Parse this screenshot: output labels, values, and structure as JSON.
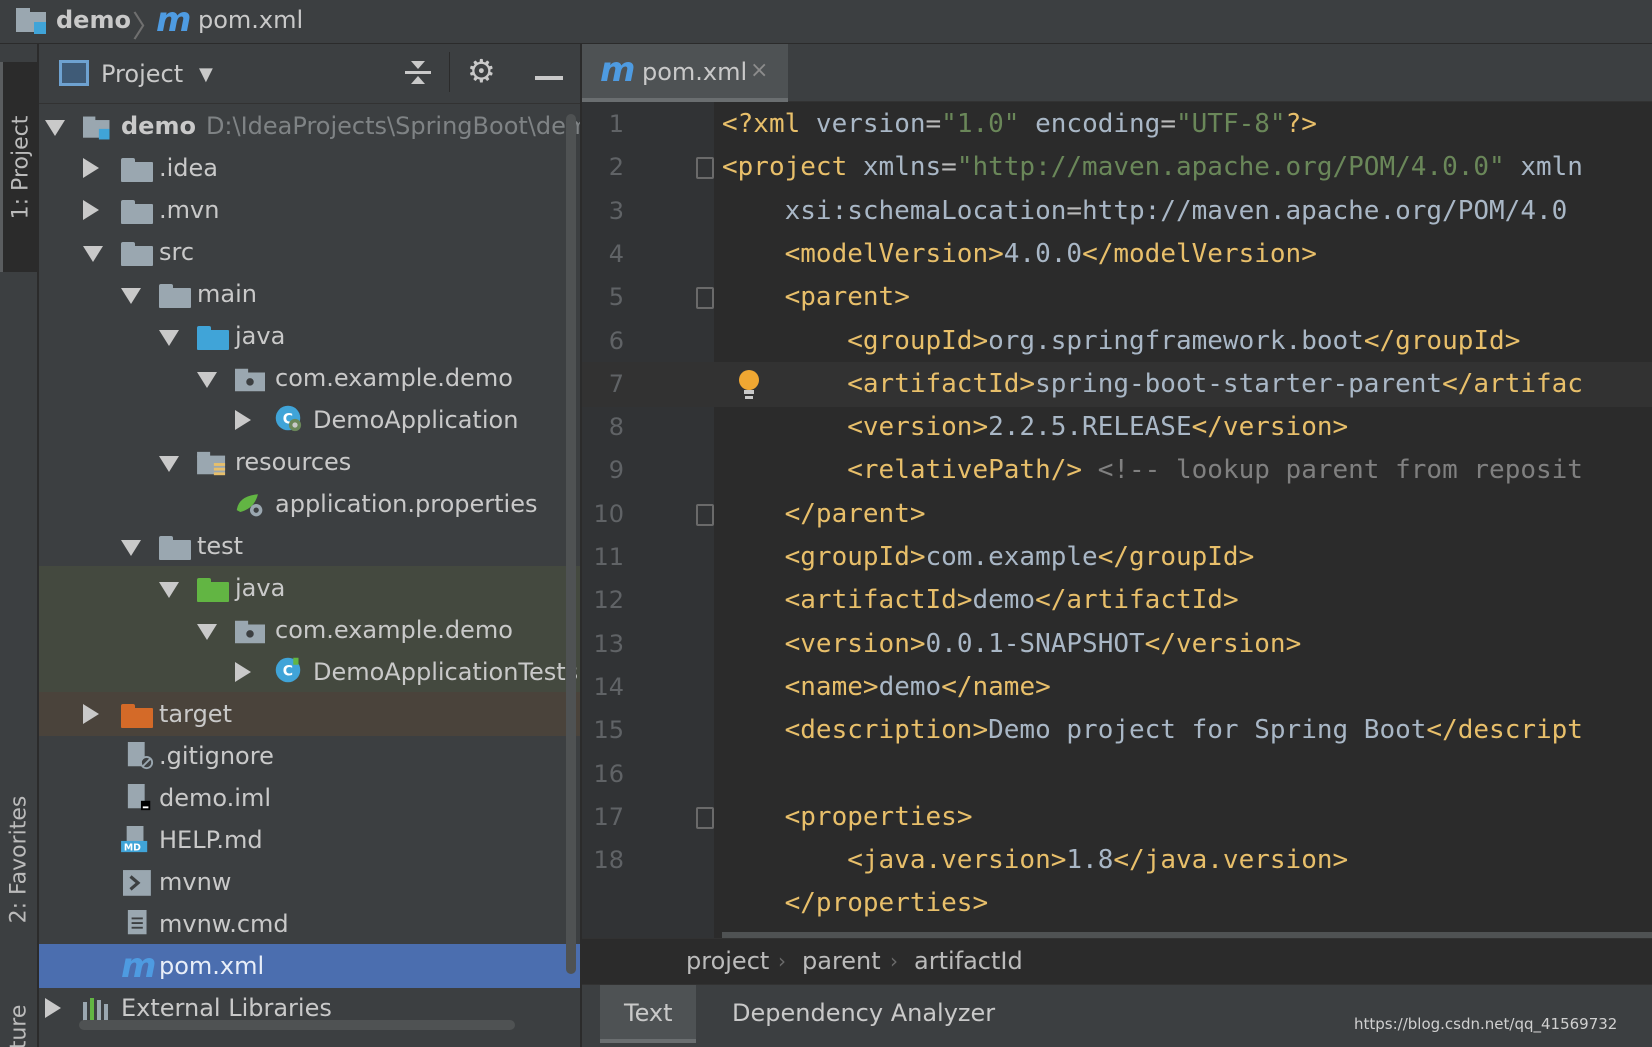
{
  "navbar": {
    "project": "demo",
    "file_icon": "m",
    "file": "pom.xml"
  },
  "left_stripe": {
    "tabs": [
      {
        "label": "1: Project"
      },
      {
        "label": "2: Favorites"
      },
      {
        "label": "ructure"
      }
    ]
  },
  "project_panel": {
    "title": "Project",
    "icons": [
      "collapse-all-icon",
      "gear-icon",
      "minimize-icon"
    ],
    "tree": [
      {
        "label": "demo",
        "path": "D:\\IdeaProjects\\SpringBoot\\dem",
        "icon": "module-folder"
      },
      {
        "label": ".idea",
        "icon": "folder"
      },
      {
        "label": ".mvn",
        "icon": "folder"
      },
      {
        "label": "src",
        "icon": "folder"
      },
      {
        "label": "main",
        "icon": "folder"
      },
      {
        "label": "java",
        "icon": "source-folder"
      },
      {
        "label": "com.example.demo",
        "icon": "package"
      },
      {
        "label": "DemoApplication",
        "icon": "spring-class"
      },
      {
        "label": "resources",
        "icon": "resources-folder"
      },
      {
        "label": "application.properties",
        "icon": "spring-properties"
      },
      {
        "label": "test",
        "icon": "folder"
      },
      {
        "label": "java",
        "icon": "test-folder"
      },
      {
        "label": "com.example.demo",
        "icon": "package"
      },
      {
        "label": "DemoApplicationTests",
        "icon": "class"
      },
      {
        "label": "target",
        "icon": "excluded-folder"
      },
      {
        "label": ".gitignore",
        "icon": "ignore-file"
      },
      {
        "label": "demo.iml",
        "icon": "iml-file"
      },
      {
        "label": "HELP.md",
        "icon": "markdown-file"
      },
      {
        "label": "mvnw",
        "icon": "shell-file"
      },
      {
        "label": "mvnw.cmd",
        "icon": "text-file"
      },
      {
        "label": "pom.xml",
        "icon": "maven-file"
      },
      {
        "label": "External Libraries",
        "icon": "libraries"
      }
    ]
  },
  "editor": {
    "tab": {
      "icon": "m",
      "label": "pom.xml",
      "close": "×"
    },
    "current_line": 7,
    "line_numbers": [
      "1",
      "2",
      "3",
      "4",
      "5",
      "6",
      "7",
      "8",
      "9",
      "10",
      "11",
      "12",
      "13",
      "14",
      "15",
      "16",
      "17",
      "18"
    ],
    "lines": [
      "<?xml version=\"1.0\" encoding=\"UTF-8\"?>",
      "<project xmlns=\"http://maven.apache.org/POM/4.0.0\" xmln",
      "    xsi:schemaLocation=\"http://maven.apache.org/POM/4.0",
      "    <modelVersion>4.0.0</modelVersion>",
      "    <parent>",
      "        <groupId>org.springframework.boot</groupId>",
      "        <artifactId>spring-boot-starter-parent</artifac",
      "        <version>2.2.5.RELEASE</version>",
      "        <relativePath/> <!-- lookup parent from reposit",
      "    </parent>",
      "    <groupId>com.example</groupId>",
      "    <artifactId>demo</artifactId>",
      "    <version>0.0.1-SNAPSHOT</version>",
      "    <name>demo</name>",
      "    <description>Demo project for Spring Boot</descript",
      "",
      "    <properties>",
      "        <java.version>1.8</java.version>"
    ],
    "partial_line": "    </properties>"
  },
  "breadcrumbs": [
    "project",
    "parent",
    "artifactId"
  ],
  "bottom_tabs": {
    "text": "Text",
    "dependency": "Dependency Analyzer"
  },
  "watermark": "https://blog.csdn.net/qq_41569732"
}
